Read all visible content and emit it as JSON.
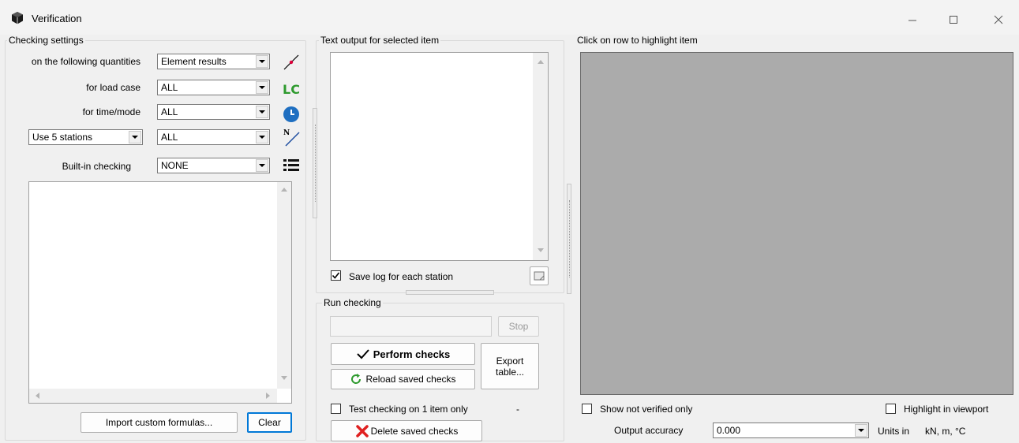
{
  "window": {
    "title": "Verification",
    "icon": "cube-icon",
    "minimize_icon": "minimize-icon",
    "maximize_icon": "maximize-icon",
    "close_icon": "close-icon"
  },
  "checking_settings": {
    "title": "Checking settings",
    "rows": [
      {
        "label": "on  the following quantities",
        "value": "Element results",
        "icon": "element-results-icon"
      },
      {
        "label": "for load case",
        "value": "ALL",
        "icon": "load-case-icon"
      },
      {
        "label": "for time/mode",
        "value": "ALL",
        "icon": "clock-icon"
      },
      {
        "label": "Use 5 stations",
        "value": "ALL",
        "icon": "stations-icon"
      },
      {
        "label": "Built-in checking",
        "value": "NONE",
        "icon": "list-icon"
      }
    ],
    "import_button": "Import custom formulas...",
    "clear_button": "Clear"
  },
  "text_output": {
    "title": "Text output for selected item",
    "save_log_label": "Save log for each station",
    "save_log_checked": true
  },
  "run_checking": {
    "title": "Run checking",
    "progress_value": "",
    "stop_button": "Stop",
    "perform_button": "Perform checks",
    "reload_button": "Reload saved checks",
    "export_button_line1": "Export",
    "export_button_line2": "table...",
    "test_one_label": "Test checking on 1 item only",
    "test_one_checked": false,
    "status_dash": "-",
    "delete_button": "Delete saved checks"
  },
  "results": {
    "title": "Click on row to highlight item",
    "grid_color": "#ababab",
    "show_not_verified_label": "Show not verified only",
    "show_not_verified_checked": false,
    "highlight_label": "Highlight in viewport",
    "highlight_checked": false,
    "accuracy_label": "Output accuracy",
    "accuracy_value": "0.000",
    "units_label": "Units in",
    "units_value": "kN, m, °C"
  }
}
